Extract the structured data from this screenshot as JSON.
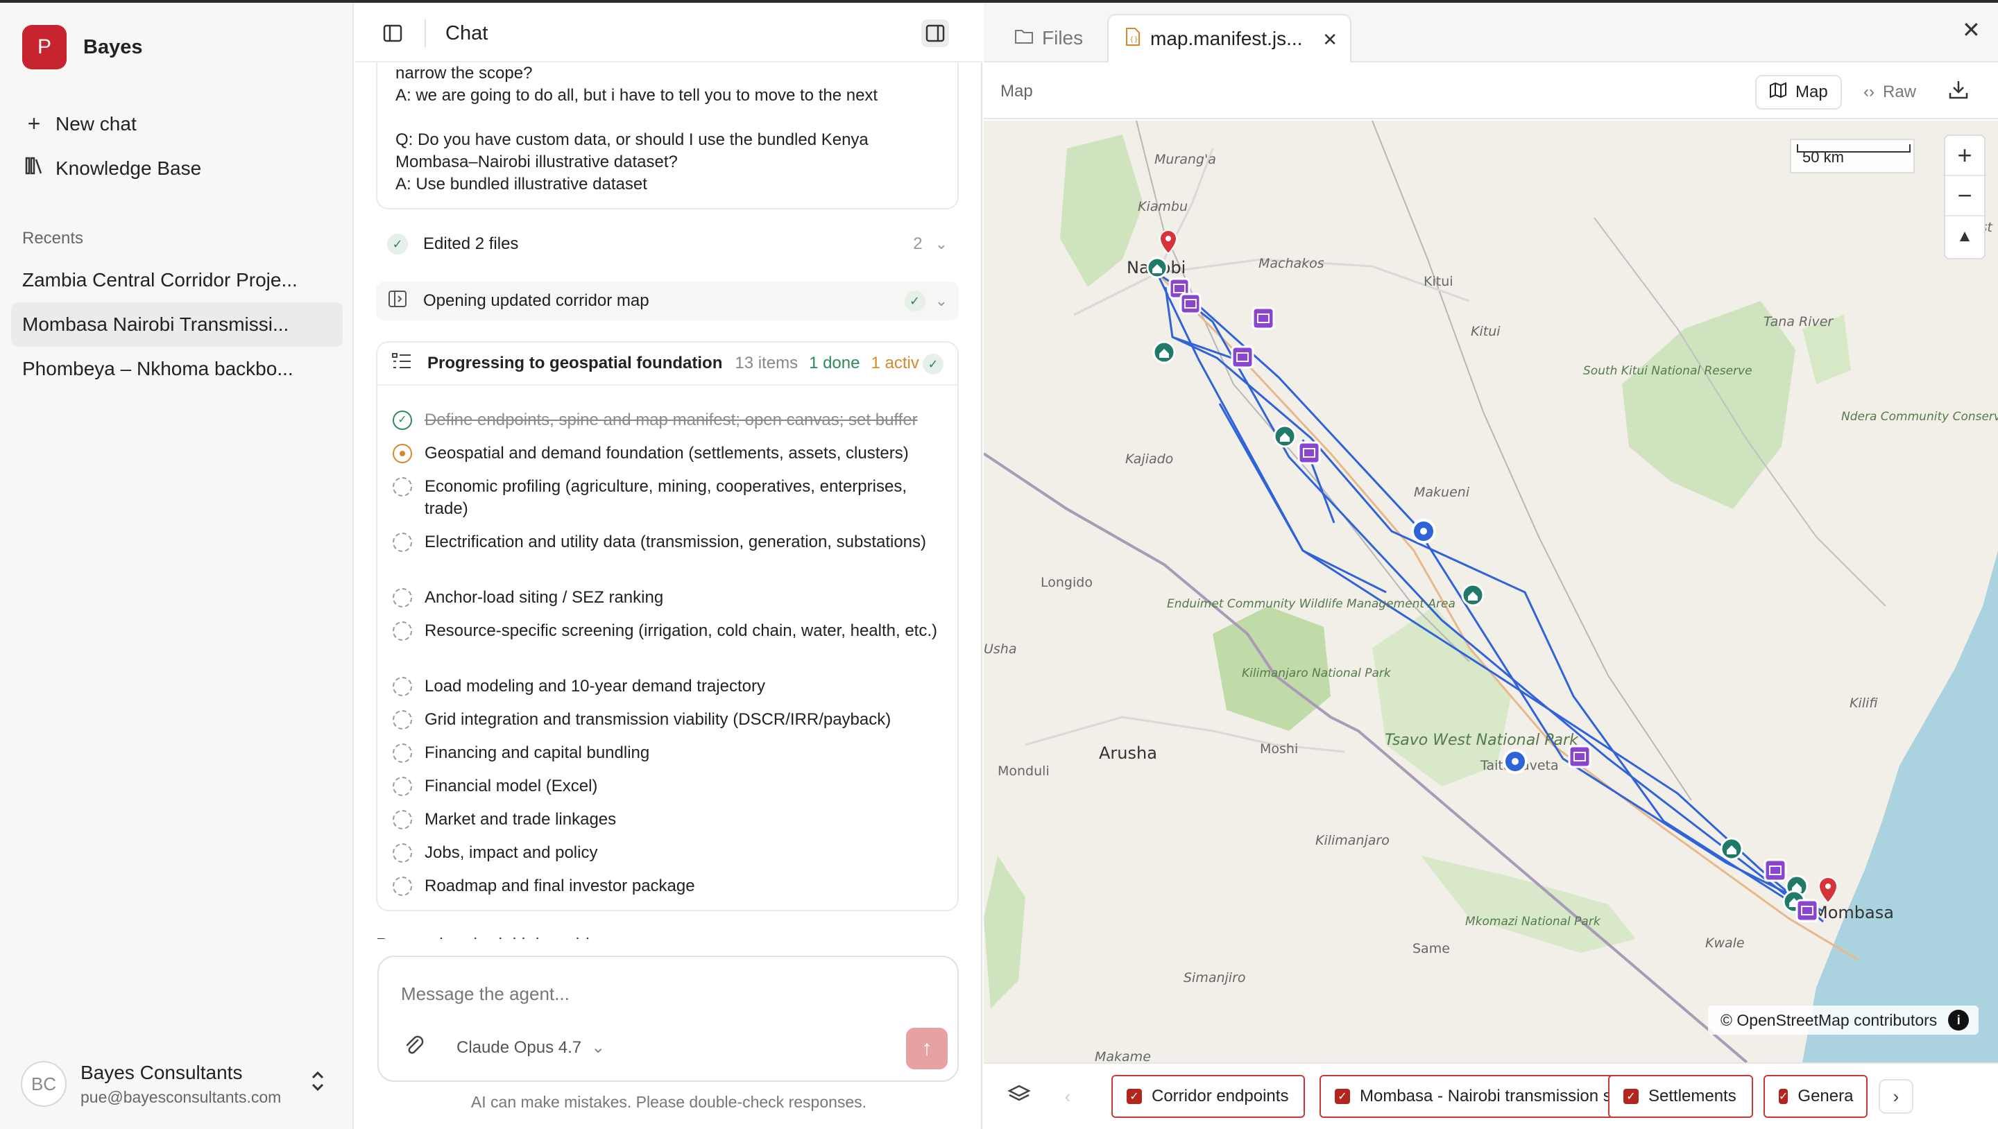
{
  "sidebar": {
    "brand_letter": "P",
    "brand_name": "Bayes",
    "new_chat": "New chat",
    "knowledge_base": "Knowledge Base",
    "recents_label": "Recents",
    "recents": [
      {
        "label": "Zambia Central Corridor Proje..."
      },
      {
        "label": "Mombasa Nairobi Transmissi..."
      },
      {
        "label": "Phombeya – Nkhoma backbo..."
      }
    ],
    "user": {
      "initials": "BC",
      "name": "Bayes Consultants",
      "email": "pue@bayesconsultants.com"
    }
  },
  "chat": {
    "title": "Chat",
    "qa_lines": [
      "narrow the scope?",
      "A: we are going to do all, but i have to tell you to move to the next",
      "",
      "Q: Do you have custom data, or should I use the bundled Kenya",
      "Mombasa–Nairobi illustrative dataset?",
      "A: Use bundled illustrative dataset"
    ],
    "edited": {
      "label": "Edited 2 files",
      "count": "2"
    },
    "opening": {
      "label": "Opening updated corridor map"
    },
    "progress": {
      "title": "Progressing to geospatial foundation",
      "items": "13 items",
      "done": "1 done",
      "active": "1 activ",
      "todos": [
        {
          "text": "Define endpoints, spine and map manifest; open canvas; set buffer",
          "status": "done"
        },
        {
          "text": "Geospatial and demand foundation (settlements, assets, clusters)",
          "status": "active"
        },
        {
          "text": "Economic profiling (agriculture, mining, cooperatives, enterprises, trade)",
          "status": "pending"
        },
        {
          "text": "Electrification and utility data (transmission, generation, substations)",
          "status": "pending"
        },
        {
          "text": "Anchor-load siting / SEZ ranking",
          "status": "pending"
        },
        {
          "text": "Resource-specific screening (irrigation, cold chain, water, health, etc.)",
          "status": "pending"
        },
        {
          "text": "Load modeling and 10-year demand trajectory",
          "status": "pending"
        },
        {
          "text": "Grid integration and transmission viability (DSCR/IRR/payback)",
          "status": "pending"
        },
        {
          "text": "Financing and capital bundling",
          "status": "pending"
        },
        {
          "text": "Financial model (Excel)",
          "status": "pending"
        },
        {
          "text": "Market and trade linkages",
          "status": "pending"
        },
        {
          "text": "Jobs, impact and policy",
          "status": "pending"
        },
        {
          "text": "Roadmap and final investor package",
          "status": "pending"
        }
      ]
    },
    "cut_text": "Proceed to the initial corridor...",
    "composer": {
      "placeholder": "Message the agent...",
      "model": "Claude Opus 4.7"
    },
    "disclaimer": "AI can make mistakes. Please double-check responses."
  },
  "right_panel": {
    "tabs": {
      "files": "Files",
      "active": "map.manifest.js..."
    },
    "map_label": "Map",
    "view_map": "Map",
    "view_raw": "Raw",
    "scale": "50 km",
    "attribution": "© OpenStreetMap contributors",
    "place_labels": [
      {
        "name": "Murang'a"
      },
      {
        "name": "Kiambu"
      },
      {
        "name": "Nairobi"
      },
      {
        "name": "Machakos"
      },
      {
        "name": "Kitui"
      },
      {
        "name": "Kitui"
      },
      {
        "name": "Tana River"
      },
      {
        "name": "South Kitui National Reserve"
      },
      {
        "name": "Ndera Community Conservancy"
      },
      {
        "name": "Kajiado"
      },
      {
        "name": "Makueni"
      },
      {
        "name": "Longido"
      },
      {
        "name": "Enduimet Community Wildlife Management Area"
      },
      {
        "name": "Kilimanjaro National Park"
      },
      {
        "name": "Arusha"
      },
      {
        "name": "Moshi"
      },
      {
        "name": "Monduli"
      },
      {
        "name": "Tsavo West National Park"
      },
      {
        "name": "Taita Taveta"
      },
      {
        "name": "Kilifi"
      },
      {
        "name": "Kilimanjaro"
      },
      {
        "name": "Mombasa"
      },
      {
        "name": "Mkomazi National Park"
      },
      {
        "name": "Same"
      },
      {
        "name": "Kwale"
      },
      {
        "name": "Simanjiro"
      },
      {
        "name": "Makame"
      },
      {
        "name": "Usha"
      },
      {
        "name": "Coast"
      }
    ],
    "layers": [
      {
        "label": "Corridor endpoints"
      },
      {
        "label": "Mombasa - Nairobi transmission spine"
      },
      {
        "label": "Settlements"
      },
      {
        "label": "Genera"
      }
    ],
    "colors": {
      "route": "#2f63d8",
      "settlement": "#1f7a6a",
      "asset": "#8a44d0",
      "endpoint": "#c8242f",
      "chip_border": "#c53a37"
    }
  }
}
